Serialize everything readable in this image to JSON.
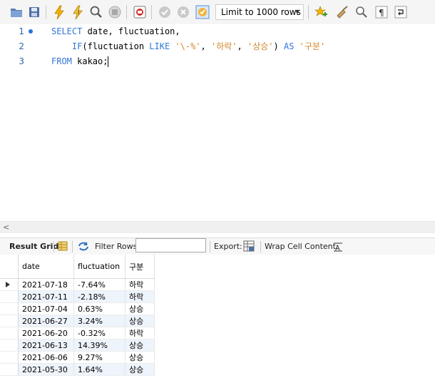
{
  "toolbar": {
    "limit_label": "Limit to 1000 rows",
    "icons": [
      "open-file",
      "save",
      "execute",
      "execute-current",
      "explain",
      "stop",
      "toggle-output",
      "commit",
      "rollback",
      "autocommit",
      "add-snippet",
      "beautify",
      "find",
      "invisible-chars",
      "wrap"
    ]
  },
  "editor": {
    "lines": [
      {
        "num": "1",
        "parts": [
          {
            "t": "SELECT ",
            "k": "kw"
          },
          {
            "t": "date, fluctuation,",
            "k": "txt"
          }
        ]
      },
      {
        "num": "2",
        "parts": [
          {
            "t": "    ",
            "k": "txt"
          },
          {
            "t": "IF",
            "k": "kw"
          },
          {
            "t": "(fluctuation ",
            "k": "txt"
          },
          {
            "t": "LIKE",
            "k": "kw"
          },
          {
            "t": " ",
            "k": "txt"
          },
          {
            "t": "'\\-%'",
            "k": "str"
          },
          {
            "t": ", ",
            "k": "txt"
          },
          {
            "t": "'하락'",
            "k": "str"
          },
          {
            "t": ", ",
            "k": "txt"
          },
          {
            "t": "'상승'",
            "k": "str"
          },
          {
            "t": ") ",
            "k": "txt"
          },
          {
            "t": "AS",
            "k": "kw"
          },
          {
            "t": " ",
            "k": "txt"
          },
          {
            "t": "'구분'",
            "k": "str"
          }
        ]
      },
      {
        "num": "3",
        "parts": [
          {
            "t": "FROM",
            "k": "kw"
          },
          {
            "t": " kakao;",
            "k": "txt"
          }
        ]
      }
    ]
  },
  "results": {
    "tab_label": "Result Grid",
    "filter_label": "Filter Rows:",
    "export_label": "Export:",
    "wrap_label": "Wrap Cell Content:",
    "columns": [
      "date",
      "fluctuation",
      "구분"
    ],
    "rows": [
      [
        "2021-07-18",
        "-7.64%",
        "하락"
      ],
      [
        "2021-07-11",
        "-2.18%",
        "하락"
      ],
      [
        "2021-07-04",
        "0.63%",
        "상승"
      ],
      [
        "2021-06-27",
        "3.24%",
        "상승"
      ],
      [
        "2021-06-20",
        "-0.32%",
        "하락"
      ],
      [
        "2021-06-13",
        "14.39%",
        "상승"
      ],
      [
        "2021-06-06",
        "9.27%",
        "상승"
      ],
      [
        "2021-05-30",
        "1.64%",
        "상승"
      ]
    ]
  }
}
